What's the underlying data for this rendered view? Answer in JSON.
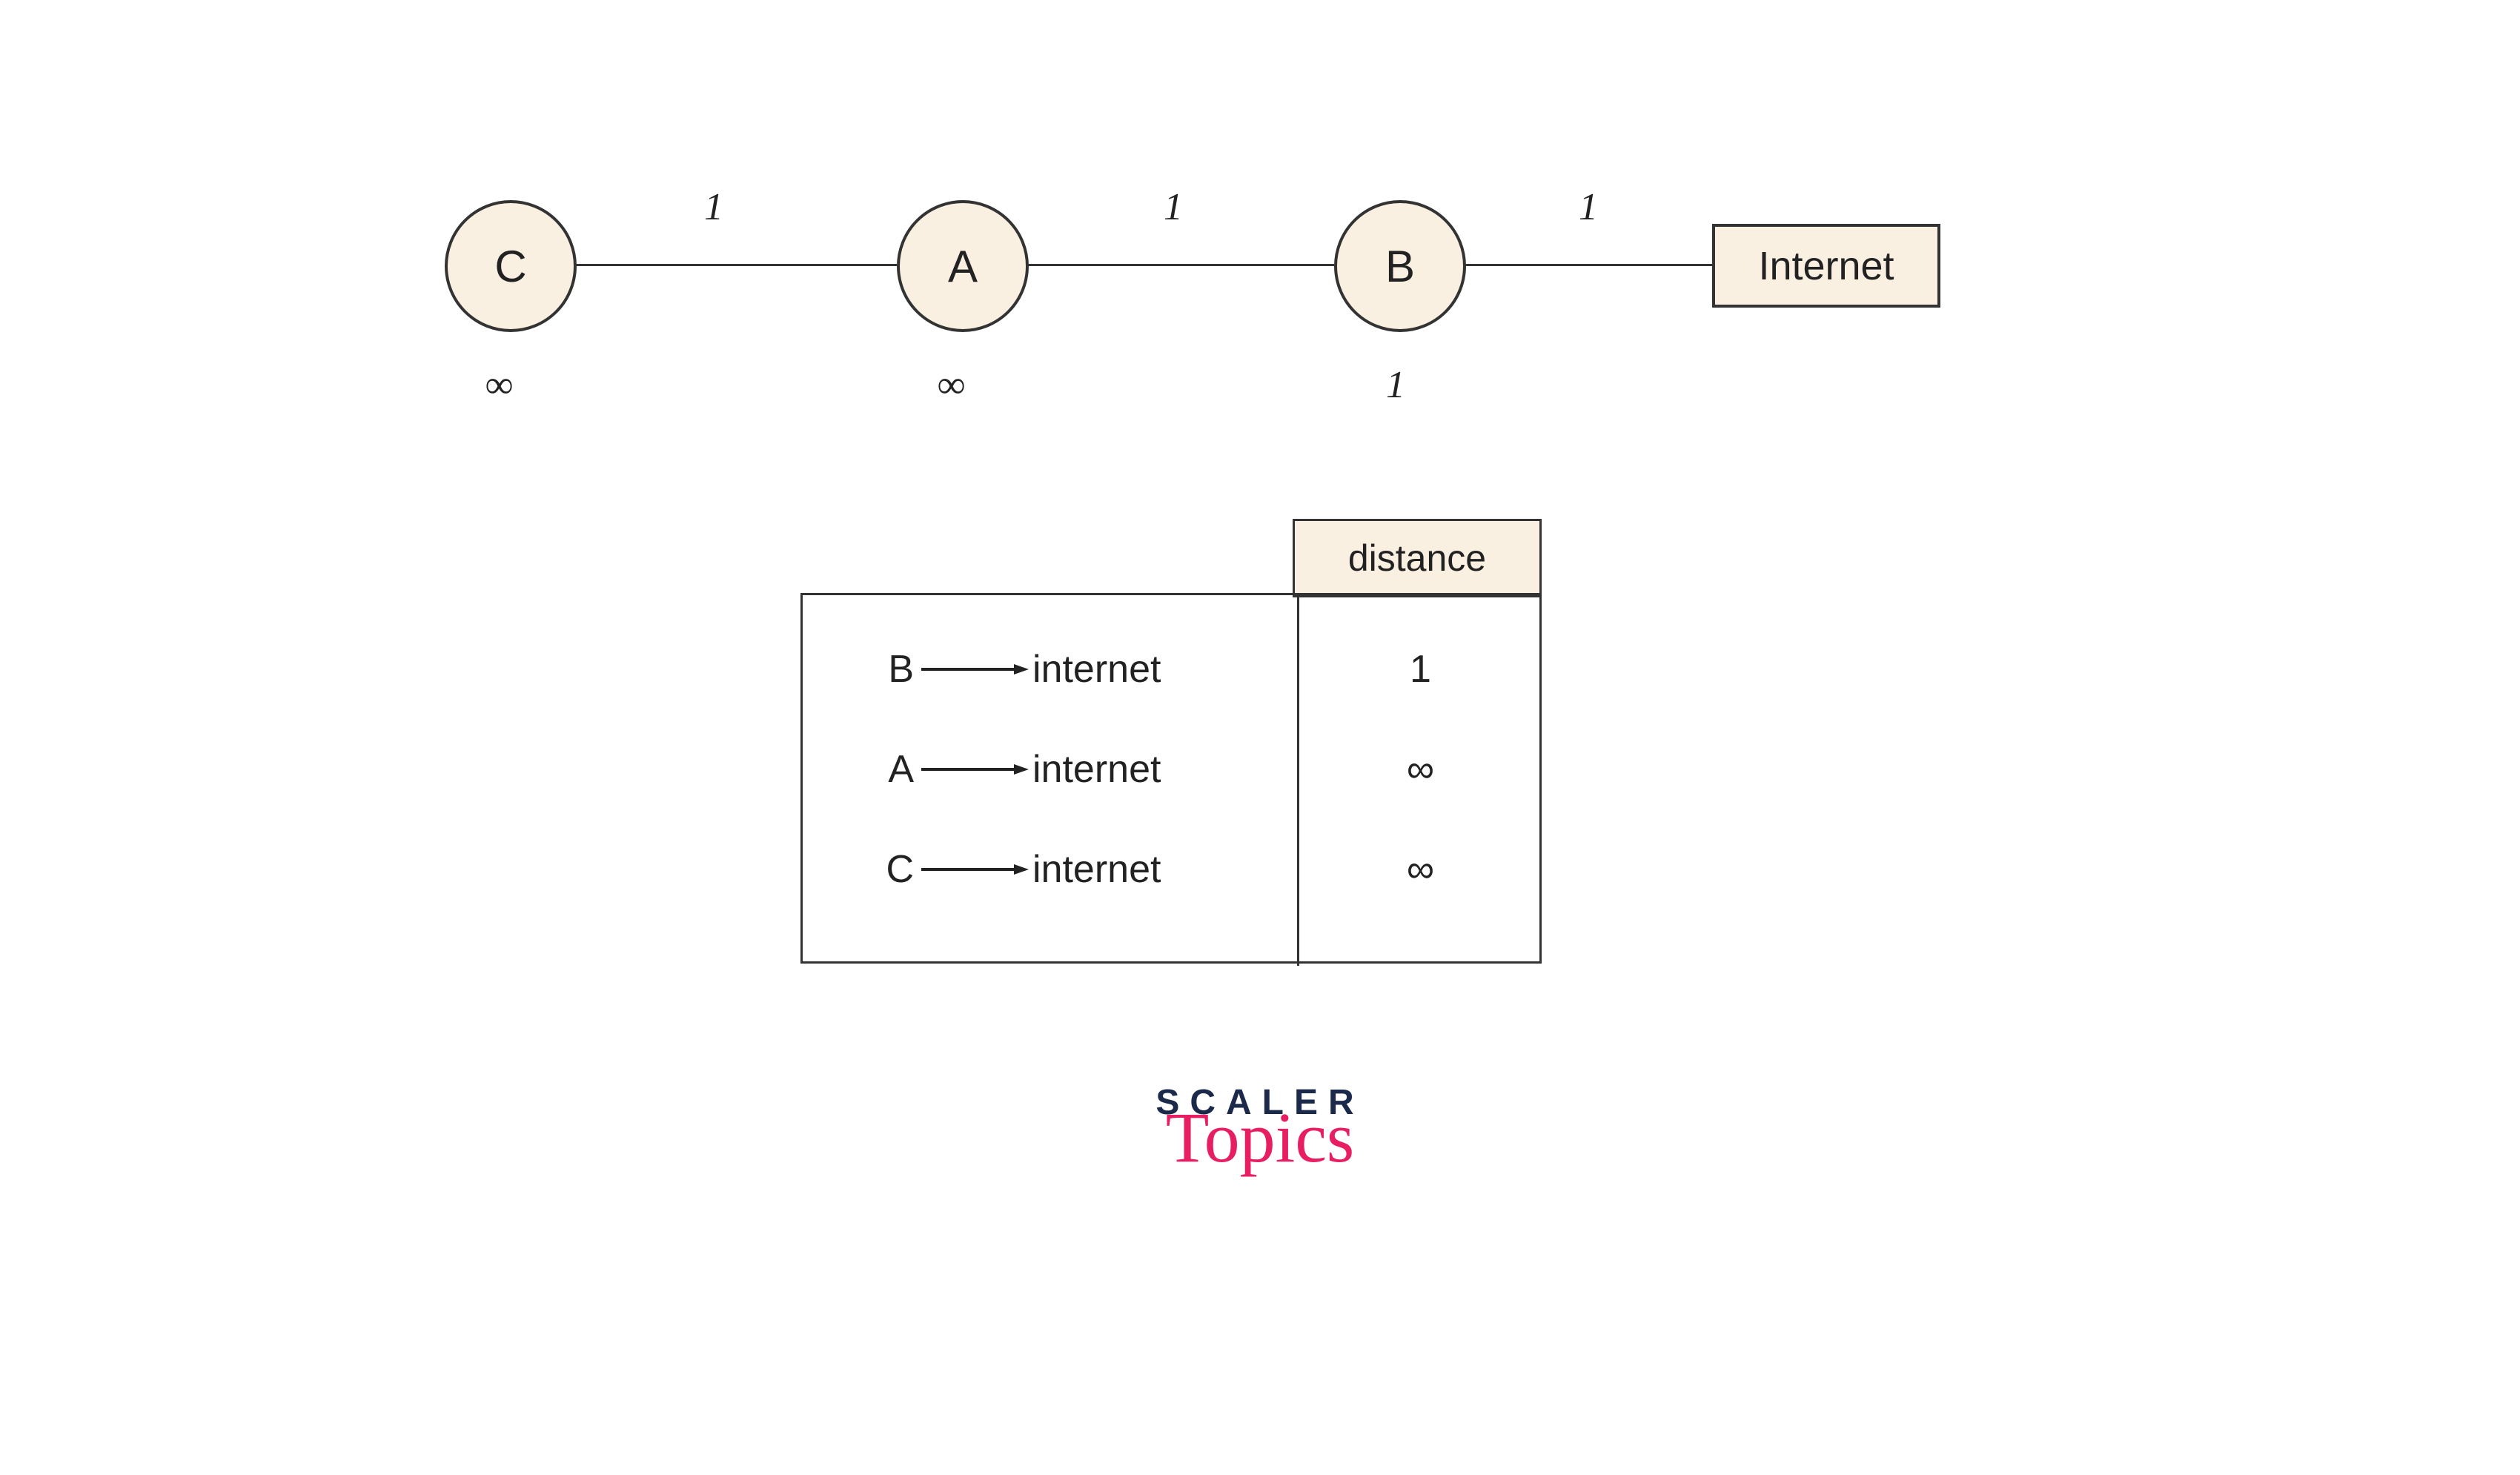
{
  "graph": {
    "nodes": {
      "c": {
        "label": "C",
        "distance": "∞"
      },
      "a": {
        "label": "A",
        "distance": "∞"
      },
      "b": {
        "label": "B",
        "distance": "1"
      },
      "internet": {
        "label": "Internet"
      }
    },
    "edges": {
      "c_a": {
        "weight": "1"
      },
      "a_b": {
        "weight": "1"
      },
      "b_internet": {
        "weight": "1"
      }
    }
  },
  "table": {
    "header": "distance",
    "rows": [
      {
        "from": "B",
        "to": "internet",
        "distance": "1"
      },
      {
        "from": "A",
        "to": "internet",
        "distance": "∞"
      },
      {
        "from": "C",
        "to": "internet",
        "distance": "∞"
      }
    ]
  },
  "logo": {
    "line1": "SCALER",
    "line2": "Topics"
  }
}
